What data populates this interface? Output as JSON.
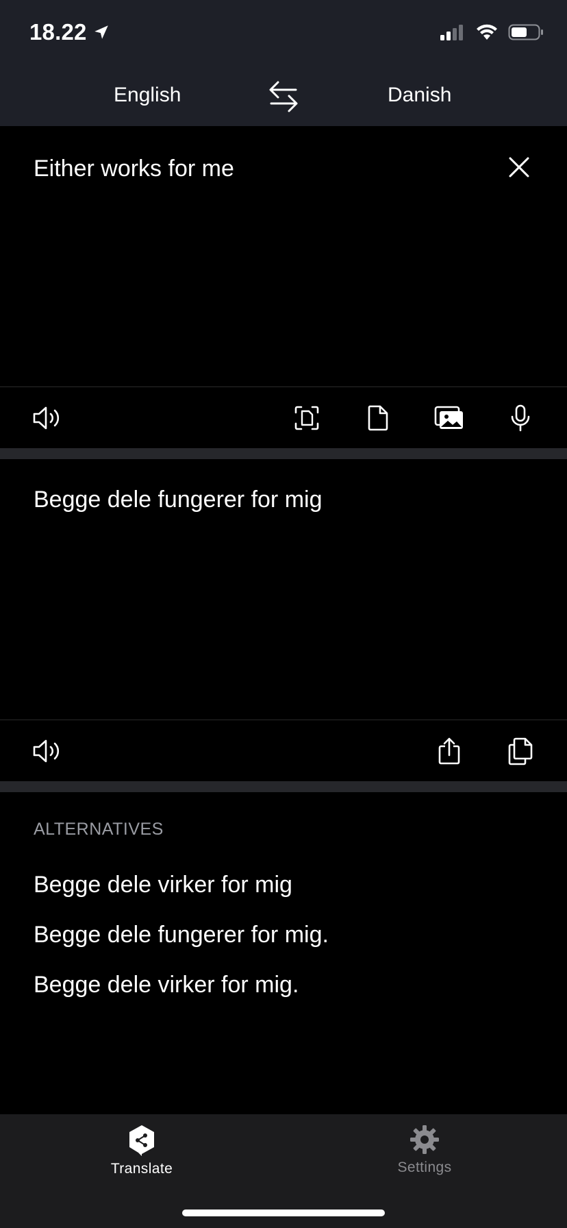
{
  "status_bar": {
    "time": "18.22",
    "icons": [
      "location-arrow-icon",
      "cellular-signal-icon",
      "wifi-icon",
      "battery-icon"
    ]
  },
  "language_bar": {
    "source_language": "English",
    "target_language": "Danish",
    "swap_icon": "swap-arrows-icon"
  },
  "source": {
    "text": "Either works for me",
    "toolbar_icons": [
      "speaker-icon",
      "scan-text-icon",
      "document-icon",
      "image-icon",
      "microphone-icon"
    ]
  },
  "target": {
    "text": "Begge dele fungerer for mig",
    "toolbar_icons": [
      "speaker-icon",
      "share-icon",
      "copy-icon"
    ]
  },
  "alternatives": {
    "header": "ALTERNATIVES",
    "items": [
      "Begge dele virker for mig",
      "Begge dele fungerer for mig.",
      "Begge dele virker for mig."
    ]
  },
  "tabbar": {
    "tabs": [
      {
        "label": "Translate",
        "icon": "translate-logo-icon",
        "active": true
      },
      {
        "label": "Settings",
        "icon": "gear-icon",
        "active": false
      }
    ]
  },
  "colors": {
    "top_bar": "#1e2028",
    "background": "#000000",
    "separator": "#26272b",
    "tabbar": "#1c1c1e",
    "muted_text": "#9a9ca3"
  }
}
